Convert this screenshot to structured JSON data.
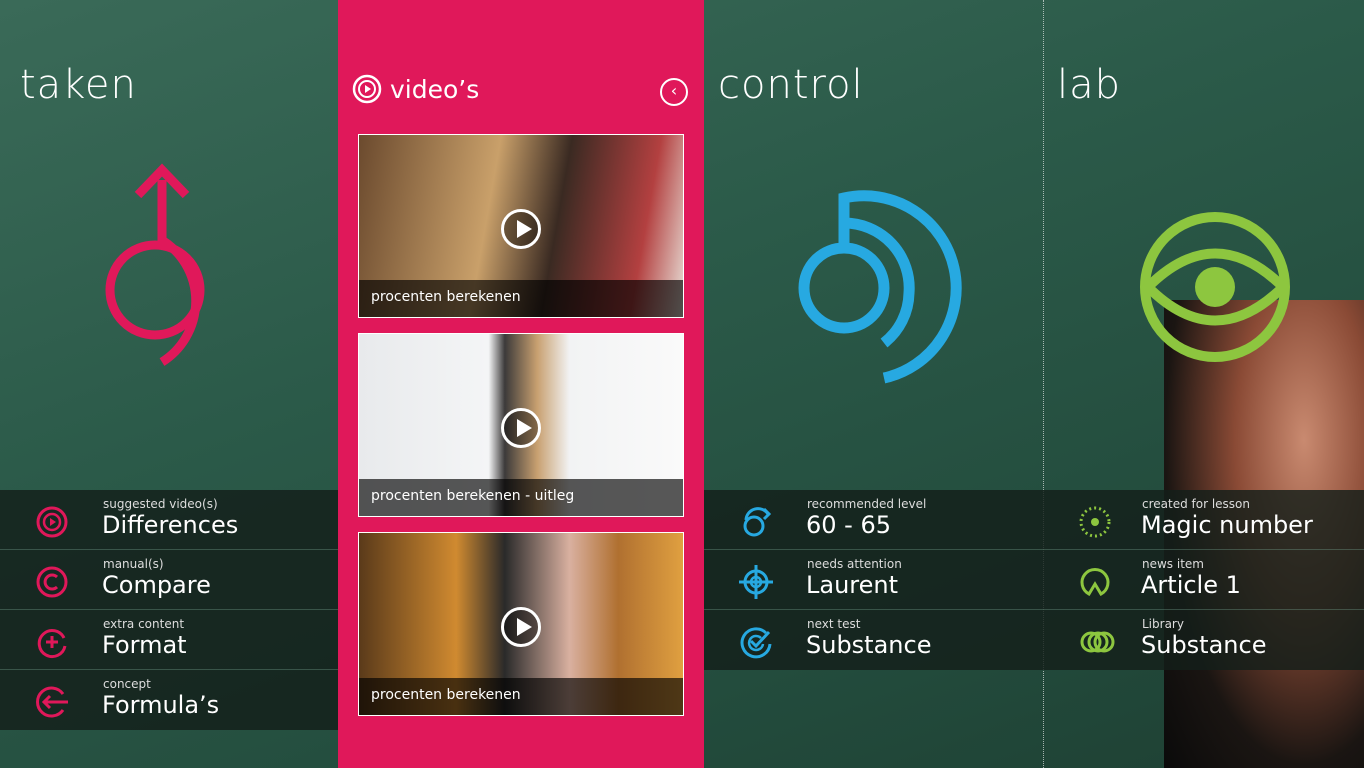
{
  "colors": {
    "taken": "#e0185a",
    "control": "#27a9e1",
    "lab": "#8dc63f"
  },
  "taken": {
    "title": "taken",
    "rows": [
      {
        "icon": "play-circle-icon",
        "label": "suggested video(s)",
        "value": "Differences"
      },
      {
        "icon": "copyright-icon",
        "label": "manual(s)",
        "value": "Compare"
      },
      {
        "icon": "plus-circle-icon",
        "label": "extra content",
        "value": "Format"
      },
      {
        "icon": "arrow-left-circle-icon",
        "label": "concept",
        "value": "Formula’s"
      }
    ]
  },
  "videos": {
    "title": "video’s",
    "items": [
      {
        "caption": "procenten berekenen"
      },
      {
        "caption": "procenten berekenen - uitleg"
      },
      {
        "caption": "procenten berekenen"
      }
    ]
  },
  "control": {
    "title": "control",
    "rows": [
      {
        "icon": "level-arrow-icon",
        "label": "recommended level",
        "value": "60 - 65"
      },
      {
        "icon": "target-icon",
        "label": "needs attention",
        "value": "Laurent"
      },
      {
        "icon": "check-circle-icon",
        "label": "next test",
        "value": "Substance"
      }
    ]
  },
  "lab": {
    "title": "lab",
    "rows": [
      {
        "icon": "dotted-circle-icon",
        "label": "created for lesson",
        "value": "Magic number"
      },
      {
        "icon": "news-icon",
        "label": "news item",
        "value": "Article 1"
      },
      {
        "icon": "library-rings-icon",
        "label": "Library",
        "value": "Substance"
      }
    ]
  }
}
